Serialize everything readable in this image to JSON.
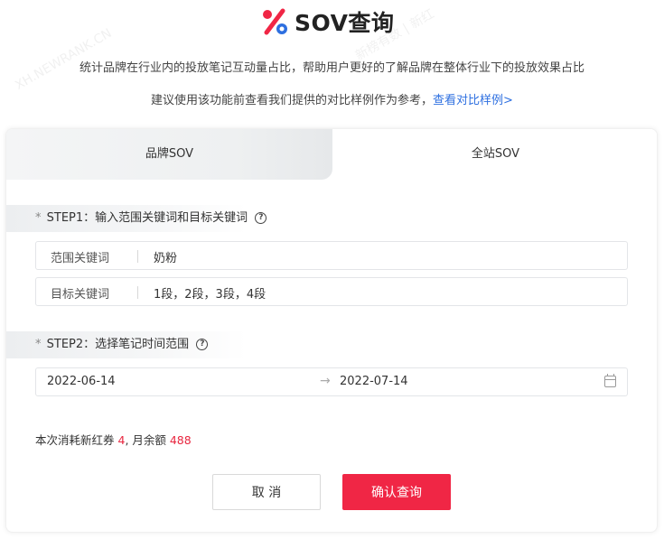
{
  "header": {
    "title": "SOV查询",
    "logo_icon": "percent-icon",
    "logo_colors": {
      "primary": "#f02645",
      "secondary": "#2d6fe0"
    }
  },
  "description": {
    "line1": "统计品牌在行业内的投放笔记互动量占比，帮助用户更好的了解品牌在整体行业下的投放效果占比",
    "line2_prefix": "建议使用该功能前查看我们提供的对比样例作为参考，",
    "line2_link": "查看对比样例>"
  },
  "tabs": [
    {
      "label": "品牌SOV",
      "active": false
    },
    {
      "label": "全站SOV",
      "active": true
    }
  ],
  "step1": {
    "required_mark": "*",
    "label": "STEP1：输入范围关键词和目标关键词",
    "help_icon": "question-circle-icon",
    "fields": [
      {
        "label": "范围关键词",
        "value": "奶粉"
      },
      {
        "label": "目标关键词",
        "value": "1段，2段，3段，4段"
      }
    ]
  },
  "step2": {
    "required_mark": "*",
    "label": "STEP2：选择笔记时间范围",
    "help_icon": "question-circle-icon",
    "date_range": {
      "start": "2022-06-14",
      "separator": "→",
      "end": "2022-07-14",
      "icon": "calendar-icon"
    }
  },
  "cost": {
    "prefix": "本次消耗新红券 ",
    "coupons": "4",
    "middle": ", 月余额 ",
    "balance": "488"
  },
  "actions": {
    "cancel_label": "取 消",
    "confirm_label": "确认查询"
  },
  "watermarks": [
    "新榜有数 | 新红",
    "XH.NEWRANK.CN"
  ],
  "colors": {
    "accent": "#f02645",
    "link": "#2d6fe0"
  }
}
